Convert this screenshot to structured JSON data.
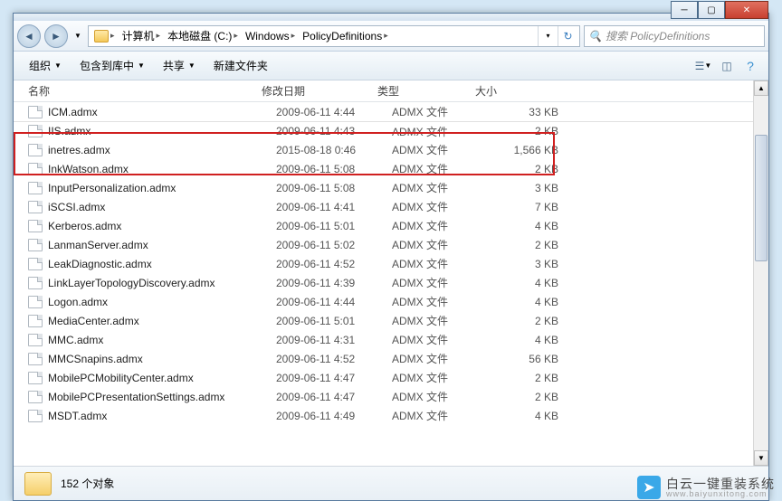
{
  "breadcrumb": {
    "items": [
      {
        "label": "计算机"
      },
      {
        "label": "本地磁盘 (C:)"
      },
      {
        "label": "Windows"
      },
      {
        "label": "PolicyDefinitions"
      }
    ]
  },
  "search": {
    "placeholder": "搜索 PolicyDefinitions"
  },
  "toolbar": {
    "organize": "组织",
    "include": "包含到库中",
    "share": "共享",
    "newfolder": "新建文件夹"
  },
  "columns": {
    "name": "名称",
    "date": "修改日期",
    "type": "类型",
    "size": "大小"
  },
  "files": [
    {
      "name": "ICM.admx",
      "date": "2009-06-11 4:44",
      "type": "ADMX 文件",
      "size": "33 KB"
    },
    {
      "name": "IIS.admx",
      "date": "2009-06-11 4:43",
      "type": "ADMX 文件",
      "size": "2 KB"
    },
    {
      "name": "inetres.admx",
      "date": "2015-08-18 0:46",
      "type": "ADMX 文件",
      "size": "1,566 KB"
    },
    {
      "name": "InkWatson.admx",
      "date": "2009-06-11 5:08",
      "type": "ADMX 文件",
      "size": "2 KB"
    },
    {
      "name": "InputPersonalization.admx",
      "date": "2009-06-11 5:08",
      "type": "ADMX 文件",
      "size": "3 KB"
    },
    {
      "name": "iSCSI.admx",
      "date": "2009-06-11 4:41",
      "type": "ADMX 文件",
      "size": "7 KB"
    },
    {
      "name": "Kerberos.admx",
      "date": "2009-06-11 5:01",
      "type": "ADMX 文件",
      "size": "4 KB"
    },
    {
      "name": "LanmanServer.admx",
      "date": "2009-06-11 5:02",
      "type": "ADMX 文件",
      "size": "2 KB"
    },
    {
      "name": "LeakDiagnostic.admx",
      "date": "2009-06-11 4:52",
      "type": "ADMX 文件",
      "size": "3 KB"
    },
    {
      "name": "LinkLayerTopologyDiscovery.admx",
      "date": "2009-06-11 4:39",
      "type": "ADMX 文件",
      "size": "4 KB"
    },
    {
      "name": "Logon.admx",
      "date": "2009-06-11 4:44",
      "type": "ADMX 文件",
      "size": "4 KB"
    },
    {
      "name": "MediaCenter.admx",
      "date": "2009-06-11 5:01",
      "type": "ADMX 文件",
      "size": "2 KB"
    },
    {
      "name": "MMC.admx",
      "date": "2009-06-11 4:31",
      "type": "ADMX 文件",
      "size": "4 KB"
    },
    {
      "name": "MMCSnapins.admx",
      "date": "2009-06-11 4:52",
      "type": "ADMX 文件",
      "size": "56 KB"
    },
    {
      "name": "MobilePCMobilityCenter.admx",
      "date": "2009-06-11 4:47",
      "type": "ADMX 文件",
      "size": "2 KB"
    },
    {
      "name": "MobilePCPresentationSettings.admx",
      "date": "2009-06-11 4:47",
      "type": "ADMX 文件",
      "size": "2 KB"
    },
    {
      "name": "MSDT.admx",
      "date": "2009-06-11 4:49",
      "type": "ADMX 文件",
      "size": "4 KB"
    }
  ],
  "status": {
    "count": "152 个对象"
  },
  "watermark": {
    "main": "白云一键重装系统",
    "sub": "www.baiyunxitong.com"
  }
}
